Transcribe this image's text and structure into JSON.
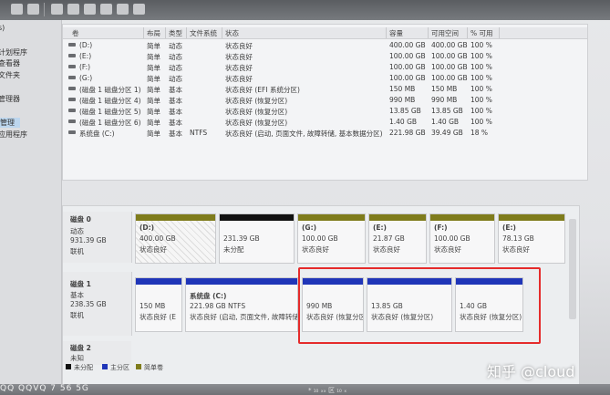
{
  "left_nav": {
    "items": [
      {
        "label": "s)"
      },
      {
        "label": "计划程序"
      },
      {
        "label": "查看器"
      },
      {
        "label": "文件夹"
      },
      {
        "label": "管理器"
      },
      {
        "label": "管理"
      },
      {
        "label": "应用程序"
      }
    ]
  },
  "volume_list": {
    "headers": [
      "卷",
      "布局",
      "类型",
      "文件系统",
      "状态",
      "容量",
      "可用空间",
      "% 可用"
    ],
    "rows": [
      {
        "vol": "(D:)",
        "layout": "简单",
        "type": "动态",
        "fs": "",
        "status": "状态良好",
        "capacity": "400.00 GB",
        "free": "400.00 GB",
        "pct": "100 %"
      },
      {
        "vol": "(E:)",
        "layout": "简单",
        "type": "动态",
        "fs": "",
        "status": "状态良好",
        "capacity": "100.00 GB",
        "free": "100.00 GB",
        "pct": "100 %"
      },
      {
        "vol": "(F:)",
        "layout": "简单",
        "type": "动态",
        "fs": "",
        "status": "状态良好",
        "capacity": "100.00 GB",
        "free": "100.00 GB",
        "pct": "100 %"
      },
      {
        "vol": "(G:)",
        "layout": "简单",
        "type": "动态",
        "fs": "",
        "status": "状态良好",
        "capacity": "100.00 GB",
        "free": "100.00 GB",
        "pct": "100 %"
      },
      {
        "vol": "(磁盘 1 磁盘分区 1)",
        "layout": "简单",
        "type": "基本",
        "fs": "",
        "status": "状态良好 (EFI 系统分区)",
        "capacity": "150 MB",
        "free": "150 MB",
        "pct": "100 %"
      },
      {
        "vol": "(磁盘 1 磁盘分区 4)",
        "layout": "简单",
        "type": "基本",
        "fs": "",
        "status": "状态良好 (恢复分区)",
        "capacity": "990 MB",
        "free": "990 MB",
        "pct": "100 %"
      },
      {
        "vol": "(磁盘 1 磁盘分区 5)",
        "layout": "简单",
        "type": "基本",
        "fs": "",
        "status": "状态良好 (恢复分区)",
        "capacity": "13.85 GB",
        "free": "13.85 GB",
        "pct": "100 %"
      },
      {
        "vol": "(磁盘 1 磁盘分区 6)",
        "layout": "简单",
        "type": "基本",
        "fs": "",
        "status": "状态良好 (恢复分区)",
        "capacity": "1.40 GB",
        "free": "1.40 GB",
        "pct": "100 %"
      },
      {
        "vol": "系统盘 (C:)",
        "layout": "简单",
        "type": "基本",
        "fs": "NTFS",
        "status": "状态良好 (启动, 页面文件, 故障转储, 基本数据分区)",
        "capacity": "221.98 GB",
        "free": "39.49 GB",
        "pct": "18 %"
      }
    ]
  },
  "disks": [
    {
      "name": "磁盘 0",
      "kind": "动态",
      "size": "931.39 GB",
      "state": "联机",
      "partitions": [
        {
          "title": "(D:)",
          "size": "400.00 GB",
          "status": "状态良好",
          "bar": "#7f7c1c"
        },
        {
          "title": "",
          "size": "231.39 GB",
          "status": "未分配",
          "bar": "#111111"
        },
        {
          "title": "(G:)",
          "size": "100.00 GB",
          "status": "状态良好",
          "bar": "#7f7c1c"
        },
        {
          "title": "(E:)",
          "size": "21.87 GB",
          "status": "状态良好",
          "bar": "#7f7c1c"
        },
        {
          "title": "(F:)",
          "size": "100.00 GB",
          "status": "状态良好",
          "bar": "#7f7c1c"
        },
        {
          "title": "(E:)",
          "size": "78.13 GB",
          "status": "状态良好",
          "bar": "#7f7c1c"
        }
      ]
    },
    {
      "name": "磁盘 1",
      "kind": "基本",
      "size": "238.35 GB",
      "state": "联机",
      "partitions": [
        {
          "title": "",
          "size": "150 MB",
          "status": "状态良好 (E",
          "bar": "#1f35b8"
        },
        {
          "title": "系统盘 (C:)",
          "size": "221.98 GB NTFS",
          "status": "状态良好 (启动, 页面文件, 故障转储",
          "bar": "#1f35b8"
        },
        {
          "title": "",
          "size": "990 MB",
          "status": "状态良好 (恢复分区)",
          "bar": "#1f35b8"
        },
        {
          "title": "",
          "size": "13.85 GB",
          "status": "状态良好 (恢复分区)",
          "bar": "#1f35b8"
        },
        {
          "title": "",
          "size": "1.40 GB",
          "status": "状态良好 (恢复分区)",
          "bar": "#1f35b8"
        }
      ]
    },
    {
      "name": "磁盘 2",
      "kind": "未知",
      "size": "",
      "state": "",
      "partitions": []
    }
  ],
  "legend": [
    {
      "label": "未分配",
      "color": "#111111"
    },
    {
      "label": "主分区",
      "color": "#1f35b8"
    },
    {
      "label": "简单卷",
      "color": "#7f7c1c"
    }
  ],
  "status_text": "QQ QQVQ 7 56 5G",
  "watermark": "知乎 @cloud",
  "bottom_mini": "* ₁₀ ₓₓ 区 ₁₀ ₓ"
}
